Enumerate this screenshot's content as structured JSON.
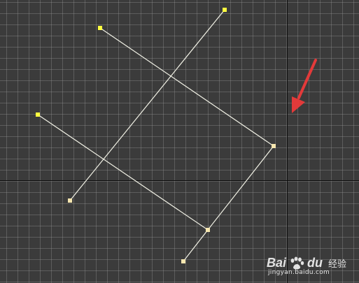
{
  "colors": {
    "background": "#3b3b3b",
    "grid": "#a0a0a0",
    "axis": "#0c0c0c",
    "spline": "#f2f2e6",
    "vertex_selected": "#ffff40",
    "vertex_normal": "#f5e6b0",
    "arrow": "#e33a3a"
  },
  "icons": {
    "annotation_arrow": "red-arrow-icon",
    "watermark_logo": "baidu-paw-icon"
  },
  "watermark": {
    "brand_left": "Bai",
    "brand_right": "du",
    "brand_cn": "经验",
    "url": "jingyan.baidu.com"
  }
}
